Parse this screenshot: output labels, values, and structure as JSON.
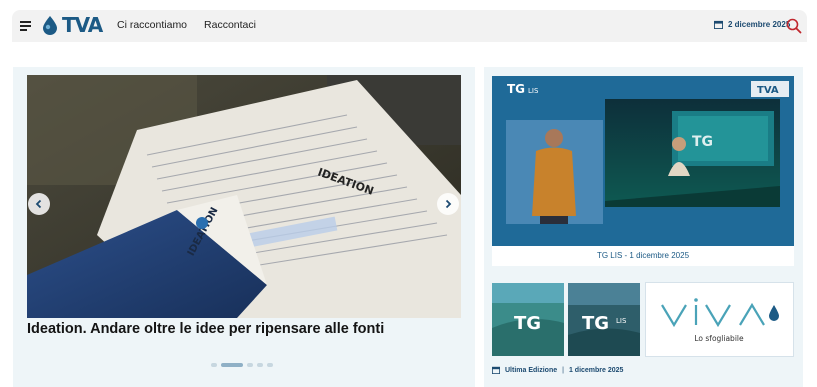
{
  "header": {
    "logo_text": "TVA",
    "nav": [
      "Ci raccontiamo",
      "Raccontaci"
    ],
    "date": "2 dicembre 2025"
  },
  "hero": {
    "headline": "Ideation. Andare oltre le idee per ripensare alle fonti",
    "book_label": "IDEATION",
    "doc_title": "IDEATION",
    "slide_count": 5,
    "active_slide": 2
  },
  "tg_lis": {
    "badge": "TG",
    "badge_sub": "LIS",
    "logo": "TVA",
    "caption": "TG LIS - 1 dicembre 2025"
  },
  "thumbs": [
    {
      "label": "TG",
      "sub": ""
    },
    {
      "label": "TG",
      "sub": "LIS"
    }
  ],
  "viva": {
    "title": "VIVA",
    "subtitle": "Lo sfogliabile"
  },
  "edition": {
    "label": "Ultima Edizione",
    "separator": "|",
    "date": "1 dicembre 2025"
  },
  "colors": {
    "brand": "#1c5a85",
    "accent_red": "#c0262d",
    "panel": "#eef5f8",
    "tg_blue": "#1f6a98"
  }
}
